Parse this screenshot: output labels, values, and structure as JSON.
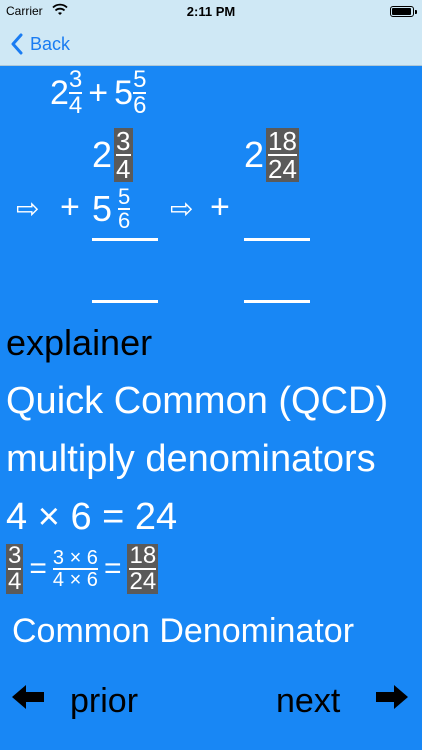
{
  "status": {
    "carrier": "Carrier",
    "time": "2:11 PM"
  },
  "nav": {
    "back_label": "Back"
  },
  "problem": {
    "whole1": "2",
    "num1": "3",
    "den1": "4",
    "op": "+",
    "whole2": "5",
    "num2": "5",
    "den2": "6"
  },
  "work": {
    "top_left_whole": "2",
    "top_left_num": "3",
    "top_left_den": "4",
    "top_right_whole": "2",
    "top_right_num": "18",
    "top_right_den": "24",
    "arrow": "⇨",
    "plus": "+",
    "mid_left_whole": "5",
    "mid_left_num": "5",
    "mid_left_den": "6"
  },
  "explain": {
    "label": "explainer",
    "line1": "Quick Common (QCD)",
    "line2": "multiply denominators",
    "line3": "4 × 6 = 24"
  },
  "equation": {
    "f1_num": "3",
    "f1_den": "4",
    "eq": "=",
    "f2_num": "3 × 6",
    "f2_den": "4 × 6",
    "f3_num": "18",
    "f3_den": "24"
  },
  "common_denominator": "Common Denominator",
  "footer": {
    "prior_label": "prior",
    "next_label": "next"
  }
}
